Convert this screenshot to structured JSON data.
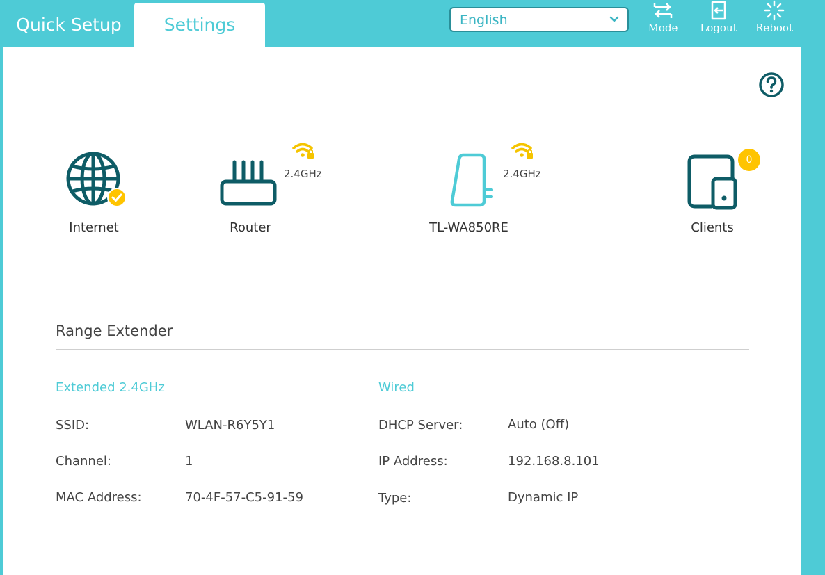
{
  "tabs": {
    "quick_setup": "Quick Setup",
    "settings": "Settings"
  },
  "language": {
    "selected": "English"
  },
  "actions": {
    "mode": "Mode",
    "logout": "Logout",
    "reboot": "Reboot"
  },
  "topology": {
    "internet": "Internet",
    "router": "Router",
    "router_band": "2.4GHz",
    "extender": "TL-WA850RE",
    "extender_band": "2.4GHz",
    "clients": "Clients",
    "clients_count": "0"
  },
  "section": {
    "title": "Range Extender"
  },
  "extended": {
    "heading": "Extended 2.4GHz",
    "rows": [
      {
        "label": "SSID:",
        "value": "WLAN-R6Y5Y1"
      },
      {
        "label": "Channel:",
        "value": "1"
      },
      {
        "label": "MAC Address:",
        "value": "70-4F-57-C5-91-59"
      }
    ]
  },
  "wired": {
    "heading": "Wired",
    "rows": [
      {
        "label": "DHCP Server:",
        "value": "Auto (Off)"
      },
      {
        "label": "IP Address:",
        "value": "192.168.8.101"
      },
      {
        "label": "Type:",
        "value": "Dynamic IP"
      }
    ]
  },
  "colors": {
    "accent": "#4ecbd6",
    "dark_teal": "#0e5c66",
    "badge": "#ffc400",
    "wifi": "#f5c400"
  }
}
